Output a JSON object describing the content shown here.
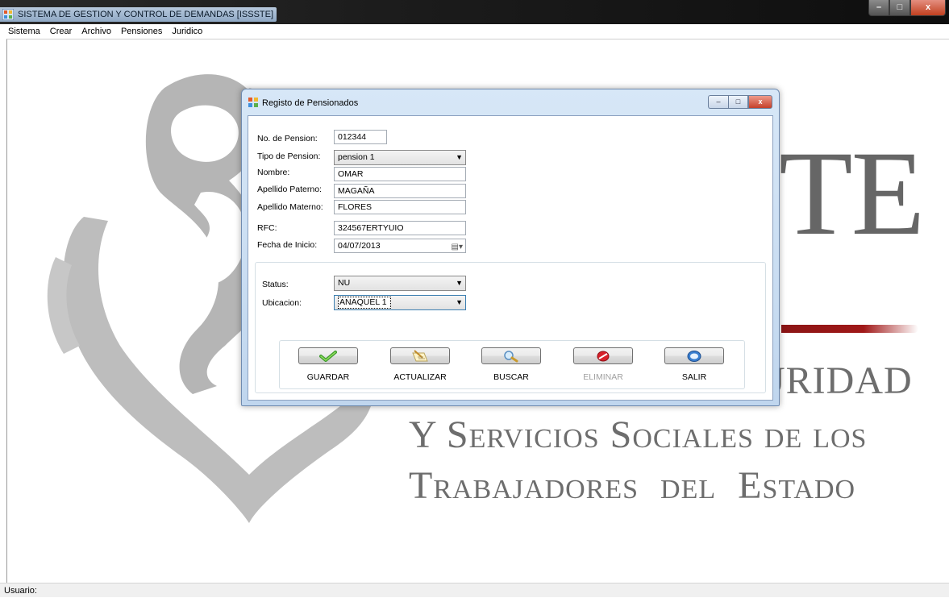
{
  "main_window": {
    "title": "SISTEMA DE GESTION Y CONTROL DE DEMANDAS [ISSSTE]",
    "controls": {
      "minimize": "–",
      "maximize": "□",
      "close": "x"
    }
  },
  "menu": {
    "items": [
      "Sistema",
      "Crear",
      "Archivo",
      "Pensiones",
      "Juridico"
    ]
  },
  "background_logo": {
    "text_te": "TE",
    "line1": "URIDAD",
    "line2": "Y Servicios Sociales de los",
    "line3": "Trabajadores del Estado"
  },
  "dialog": {
    "title": "Registo de Pensionados",
    "controls": {
      "minimize": "–",
      "maximize": "□",
      "close": "x"
    },
    "fields": {
      "no_pension": {
        "label": "No. de Pension:",
        "value": "012344"
      },
      "tipo_pension": {
        "label": "Tipo de Pension:",
        "value": "pension 1"
      },
      "nombre": {
        "label": "Nombre:",
        "value": "OMAR"
      },
      "apellido_paterno": {
        "label": "Apellido Paterno:",
        "value": "MAGAÑA"
      },
      "apellido_materno": {
        "label": "Apellido Materno:",
        "value": "FLORES"
      },
      "rfc": {
        "label": "RFC:",
        "value": "324567ERTYUIO"
      },
      "fecha_inicio": {
        "label": "Fecha de Inicio:",
        "value": "04/07/2013"
      },
      "status": {
        "label": "Status:",
        "value": "NU"
      },
      "ubicacion": {
        "label": "Ubicacion:",
        "value": "ANAQUEL 1"
      }
    },
    "buttons": {
      "guardar": "GUARDAR",
      "actualizar": "ACTUALIZAR",
      "buscar": "BUSCAR",
      "eliminar": "ELIMINAR",
      "salir": "SALIR"
    }
  },
  "statusbar": {
    "usuario_label": "Usuario:"
  }
}
